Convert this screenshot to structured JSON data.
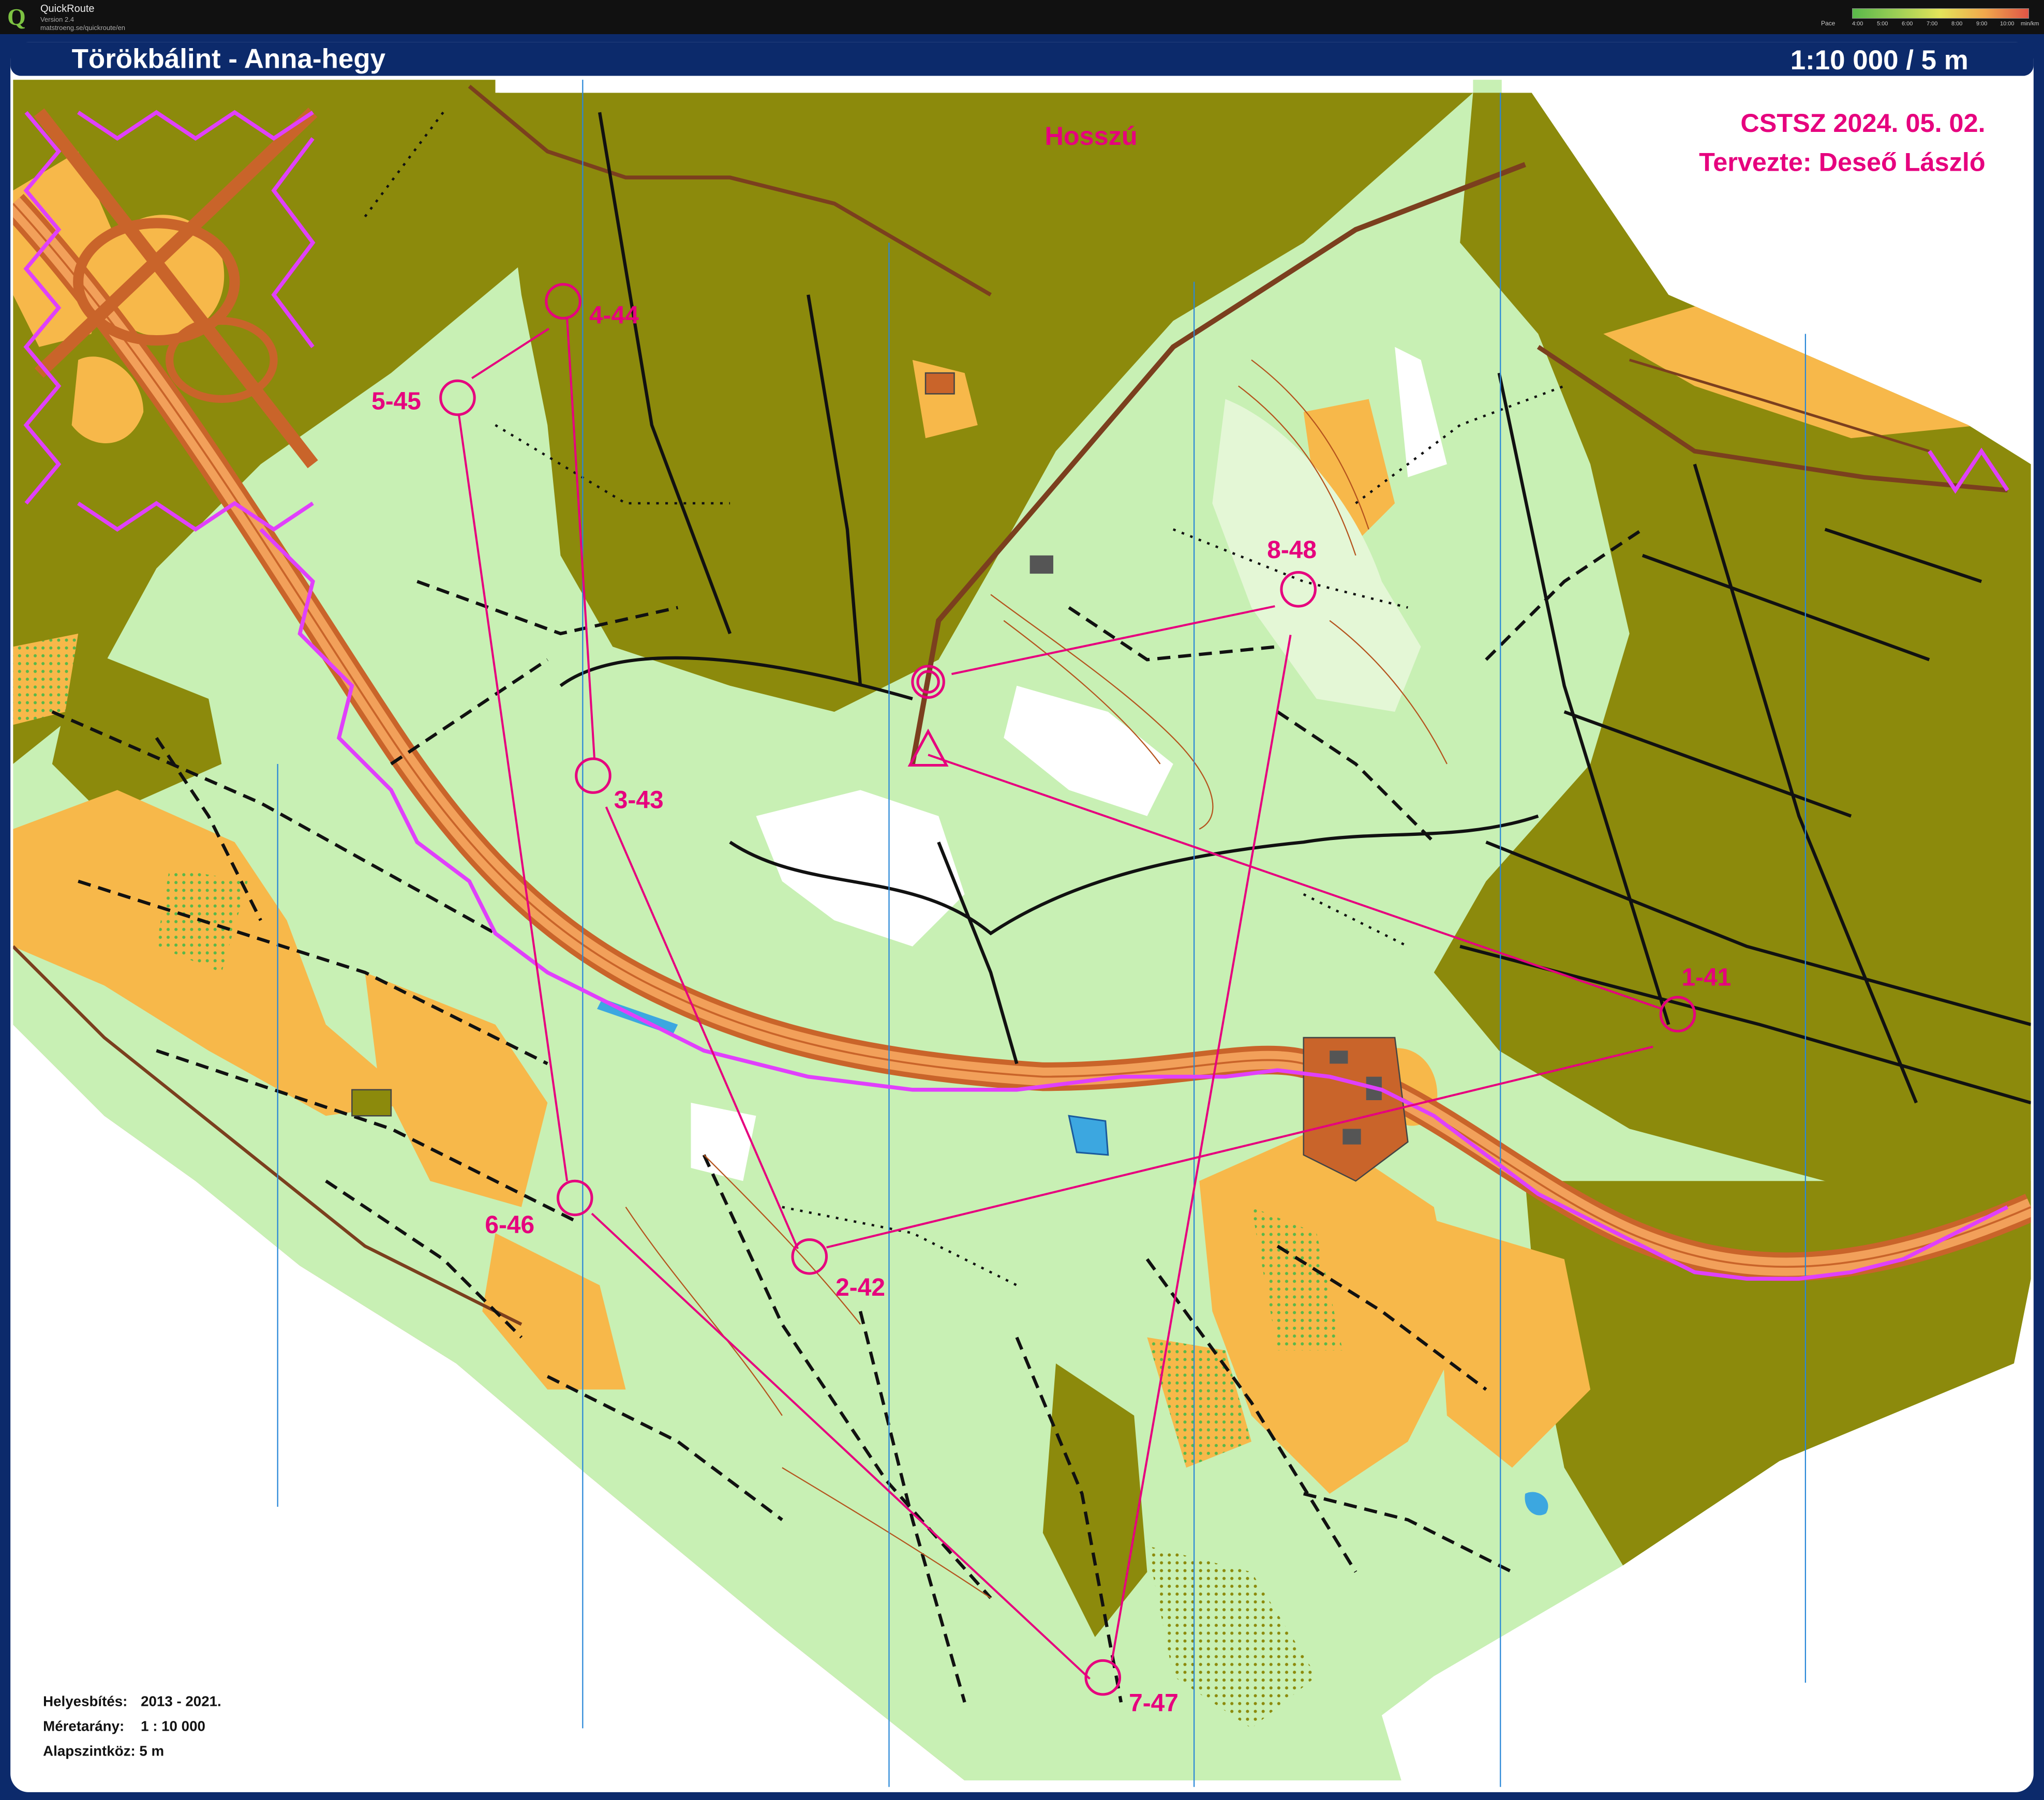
{
  "app": {
    "name": "QuickRoute",
    "version": "Version 2.4",
    "url": "matstroeng.se/quickroute/en",
    "pace_legend": {
      "label": "Pace",
      "ticks": [
        "4:00",
        "5:00",
        "6:00",
        "7:00",
        "8:00",
        "9:00",
        "10:00",
        "min/km"
      ]
    }
  },
  "map": {
    "title": "Törökbálint - Anna-hegy",
    "scale_header": "1:10 000 / 5 m",
    "course_name": "Hosszú",
    "event_line": "CSTSZ  2024. 05. 02.",
    "setter_line": "Tervezte: Deseő László",
    "colors": {
      "course": "#e6007e",
      "forest": "#8c8a0c",
      "runnable": "#c8f0b4",
      "open": "#f7b84a",
      "banner": "#0c2a6b",
      "white": "#ffffff"
    },
    "controls": [
      {
        "id": "start",
        "label": "",
        "type": "start"
      },
      {
        "id": "c1",
        "label": "1-41"
      },
      {
        "id": "c2",
        "label": "2-42"
      },
      {
        "id": "c3",
        "label": "3-43"
      },
      {
        "id": "c4",
        "label": "4-44"
      },
      {
        "id": "c5",
        "label": "5-45"
      },
      {
        "id": "c6",
        "label": "6-46"
      },
      {
        "id": "c7",
        "label": "7-47"
      },
      {
        "id": "c8",
        "label": "8-48"
      },
      {
        "id": "finish",
        "label": "",
        "type": "finish"
      }
    ],
    "info": {
      "rows": [
        {
          "key": "Helyesbítés:",
          "value": "2013 - 2021."
        },
        {
          "key": "Méretarány:",
          "value": "1 : 10 000"
        },
        {
          "key": "Alapszintköz: 5 m",
          "value": ""
        }
      ]
    }
  }
}
